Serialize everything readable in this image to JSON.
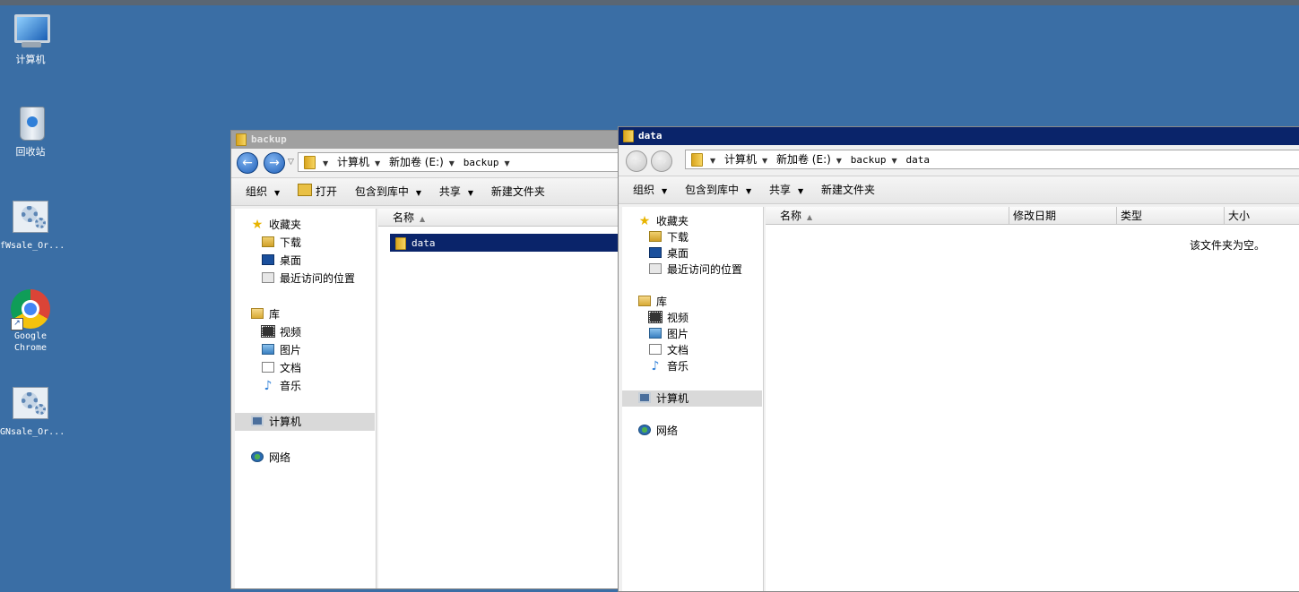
{
  "desktop": {
    "icons": [
      {
        "label": "计算机",
        "icon": "computer-icon"
      },
      {
        "label": "回收站",
        "icon": "recycle-bin-icon"
      },
      {
        "label": "fWsale_Or...",
        "icon": "settings-shortcut-icon"
      },
      {
        "label": "Google",
        "label2": "Chrome",
        "icon": "chrome-icon"
      },
      {
        "label": "GNsale_Or...",
        "icon": "settings-shortcut-icon"
      }
    ]
  },
  "window_backup": {
    "title": "backup",
    "breadcrumb": [
      "计算机",
      "新加卷 (E:)",
      "backup"
    ],
    "toolbar": {
      "organize": "组织",
      "open": "打开",
      "include_in_library": "包含到库中",
      "share": "共享",
      "new_folder": "新建文件夹"
    },
    "nav": {
      "favorites": "收藏夹",
      "favorites_items": [
        "下载",
        "桌面",
        "最近访问的位置"
      ],
      "libraries": "库",
      "library_items": [
        "视频",
        "图片",
        "文档",
        "音乐"
      ],
      "computer": "计算机",
      "network": "网络"
    },
    "columns": {
      "name": "名称"
    },
    "files": [
      {
        "name": "data",
        "selected": true
      }
    ]
  },
  "window_data": {
    "title": "data",
    "breadcrumb": [
      "计算机",
      "新加卷 (E:)",
      "backup",
      "data"
    ],
    "toolbar": {
      "organize": "组织",
      "include_in_library": "包含到库中",
      "share": "共享",
      "new_folder": "新建文件夹"
    },
    "nav": {
      "favorites": "收藏夹",
      "favorites_items": [
        "下载",
        "桌面",
        "最近访问的位置"
      ],
      "libraries": "库",
      "library_items": [
        "视频",
        "图片",
        "文档",
        "音乐"
      ],
      "computer": "计算机",
      "network": "网络"
    },
    "columns": {
      "name": "名称",
      "modified": "修改日期",
      "type": "类型",
      "size": "大小"
    },
    "empty_message": "该文件夹为空。"
  },
  "colors": {
    "desktop": "#3a6ea5",
    "active_title": "#0a246a",
    "inactive_title": "#a0a0a0",
    "selection": "#0a246a"
  }
}
